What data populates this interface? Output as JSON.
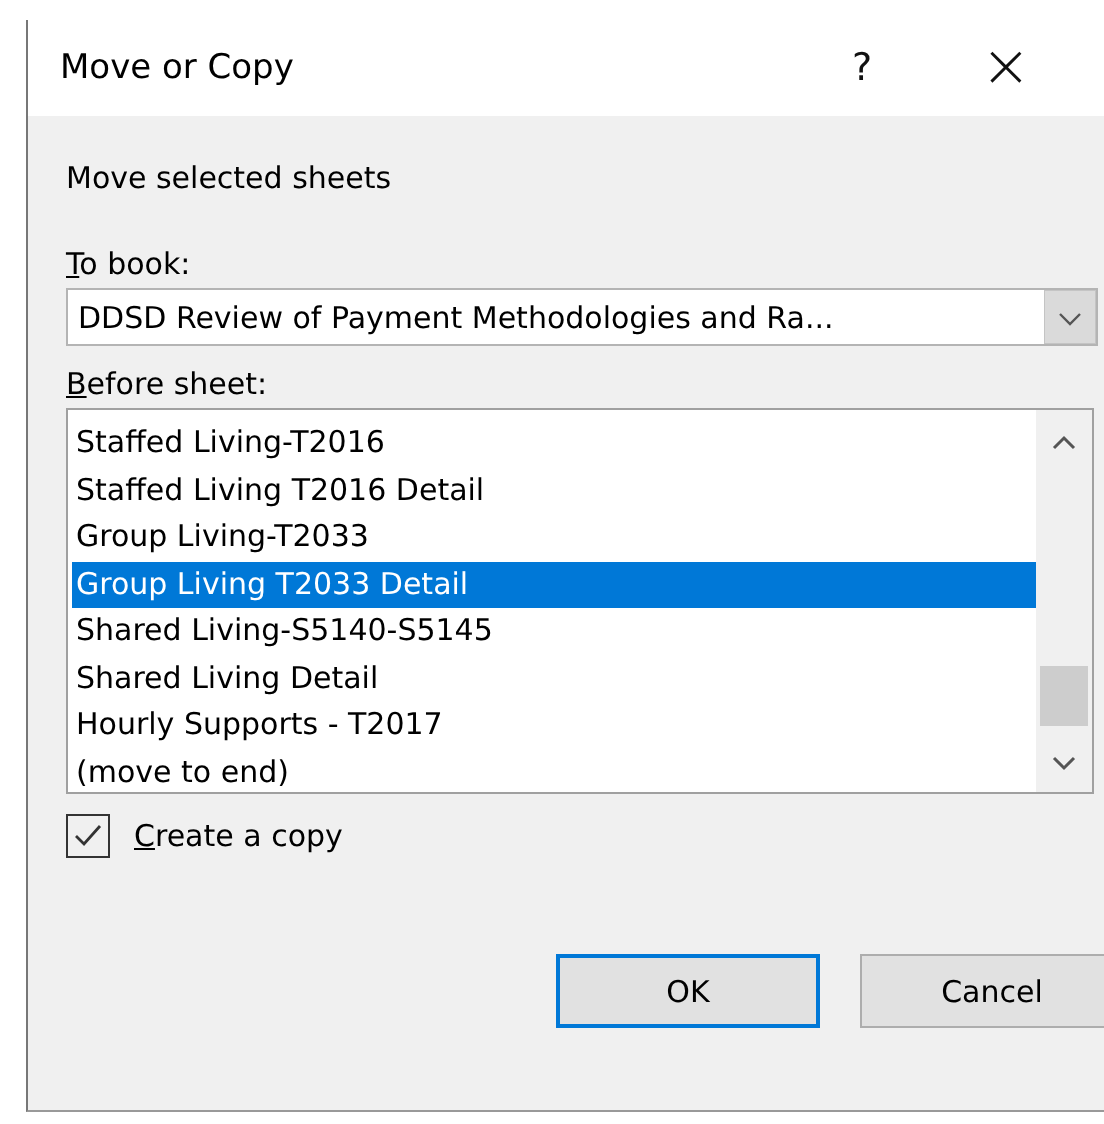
{
  "window": {
    "title": "Move or Copy",
    "help": "?",
    "close": "×"
  },
  "heading": "Move selected sheets",
  "to_book": {
    "label": {
      "access_key": "T",
      "rest": "o book:"
    },
    "value": "DDSD Review of Payment Methodologies and Ra..."
  },
  "before_sheet": {
    "label": {
      "access_key": "B",
      "rest": "efore sheet:"
    },
    "items": [
      {
        "text": "Staffed Living-T2016",
        "selected": false
      },
      {
        "text": "Staffed Living T2016 Detail",
        "selected": false
      },
      {
        "text": "Group Living-T2033",
        "selected": false
      },
      {
        "text": "Group Living T2033 Detail",
        "selected": true
      },
      {
        "text": "Shared Living-S5140-S5145",
        "selected": false
      },
      {
        "text": "Shared Living Detail",
        "selected": false
      },
      {
        "text": "Hourly Supports - T2017",
        "selected": false
      },
      {
        "text": "(move to end)",
        "selected": false
      }
    ]
  },
  "create_copy": {
    "label": {
      "access_key": "C",
      "rest": "reate a copy"
    },
    "checked": true
  },
  "buttons": [
    {
      "label": "OK",
      "default": true
    },
    {
      "label": "Cancel",
      "default": false
    }
  ]
}
